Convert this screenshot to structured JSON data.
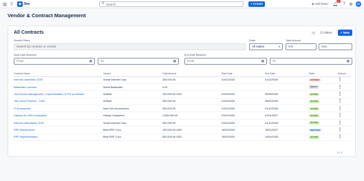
{
  "topbar": {
    "grid_icon": "grid-icon",
    "menu_icon": "menu-icon",
    "app_name": "Jira",
    "search_placeholder": "Search",
    "create_label": "+ Create",
    "ask_rovo_label": "Ask Rovo",
    "notification_count": "9+",
    "avatar_initials": "JM"
  },
  "page": {
    "title": "Vendor & Contract Management"
  },
  "contracts": {
    "title": "All Contracts",
    "count": "9",
    "filters_label": "Filters",
    "new_label": "+ New",
    "filters": {
      "search_label": "Search Filters",
      "search_placeholder": "Search by contract or vendor",
      "state_label": "State",
      "state_value": "All states",
      "total_amount_label": "Total Amount",
      "min_placeholder": "Min",
      "max_placeholder": "Max",
      "start_date_label": "Start Date Between",
      "start_from_placeholder": "From",
      "start_to_placeholder": "To",
      "end_date_label": "End Date Between",
      "end_from_placeholder": "From",
      "end_to_placeholder": "To"
    },
    "columns": [
      "Contract Name",
      "Vendor",
      "Total Amount",
      "Start Date",
      "End Date",
      "State",
      "Actions"
    ],
    "rows": [
      {
        "name": "Internet connection 2025",
        "vendor": "Smart Internet Corp.",
        "amount": "250,000.00",
        "start": "01/01/2025",
        "end": "01/12/2025",
        "state": "EXPIRED",
        "state_class": "st-expired"
      },
      {
        "name": "Balsamiks Licenses",
        "vendor": "Wired Balsamiks",
        "amount": "0.00",
        "start": "",
        "end": "",
        "state": "DRAFT",
        "state_class": "st-draft"
      },
      {
        "name": "Jira Service Management - Implementation of ITIL processes",
        "vendor": "Artibalt",
        "amount": "700,000.00 USD",
        "start": "01/02/2026",
        "end": "30/06/2026",
        "state": "ACTIVE",
        "state_class": "st-active"
      },
      {
        "name": "Jira Cloud Premium - 1000",
        "vendor": "Artibalt",
        "amount": "250,000.00",
        "start": "01/02/2026",
        "end": "28/02/2026",
        "state": "ACTIVE",
        "state_class": "st-active"
      },
      {
        "name": "IT Accessories",
        "vendor": "Next Gen Accessories",
        "amount": "250,000.00",
        "start": "01/01/2026",
        "end": "01/12/2026",
        "state": "ACTIVE",
        "state_class": "st-active"
      },
      {
        "name": "Laptops for 1000 employees",
        "vendor": "Handy Computers",
        "amount": "1,000,000.00",
        "start": "01/01/2026",
        "end": "01/01/2027",
        "state": "ACTIVE",
        "state_class": "st-active"
      },
      {
        "name": "Internet subscription 2026",
        "vendor": "Smart Internet Corp.",
        "amount": "500,000.00",
        "start": "01/01/2026",
        "end": "01/12/2026",
        "state": "ACTIVE",
        "state_class": "st-active"
      },
      {
        "name": "ERP Maintenance",
        "vendor": "Best ERP Corp.",
        "amount": "100,000.00 USD",
        "start": "16/02/2026",
        "end": "15/02/2027",
        "state": "INACTIVE",
        "state_class": "st-inactive"
      },
      {
        "name": "ERP Implementation",
        "vendor": "Best ERP Corp.",
        "amount": "500,000.00 USD",
        "start": "15/02/2025",
        "end": "14/04/2026",
        "state": "ACTIVE",
        "state_class": "st-active"
      }
    ],
    "pager": "1 / 1"
  },
  "colors": {
    "brand": "#0c66e4",
    "expired": "#ffd5d2",
    "active": "#d3f1a7",
    "inactive": "#cce0ff",
    "draft": "#dcdfe4"
  }
}
